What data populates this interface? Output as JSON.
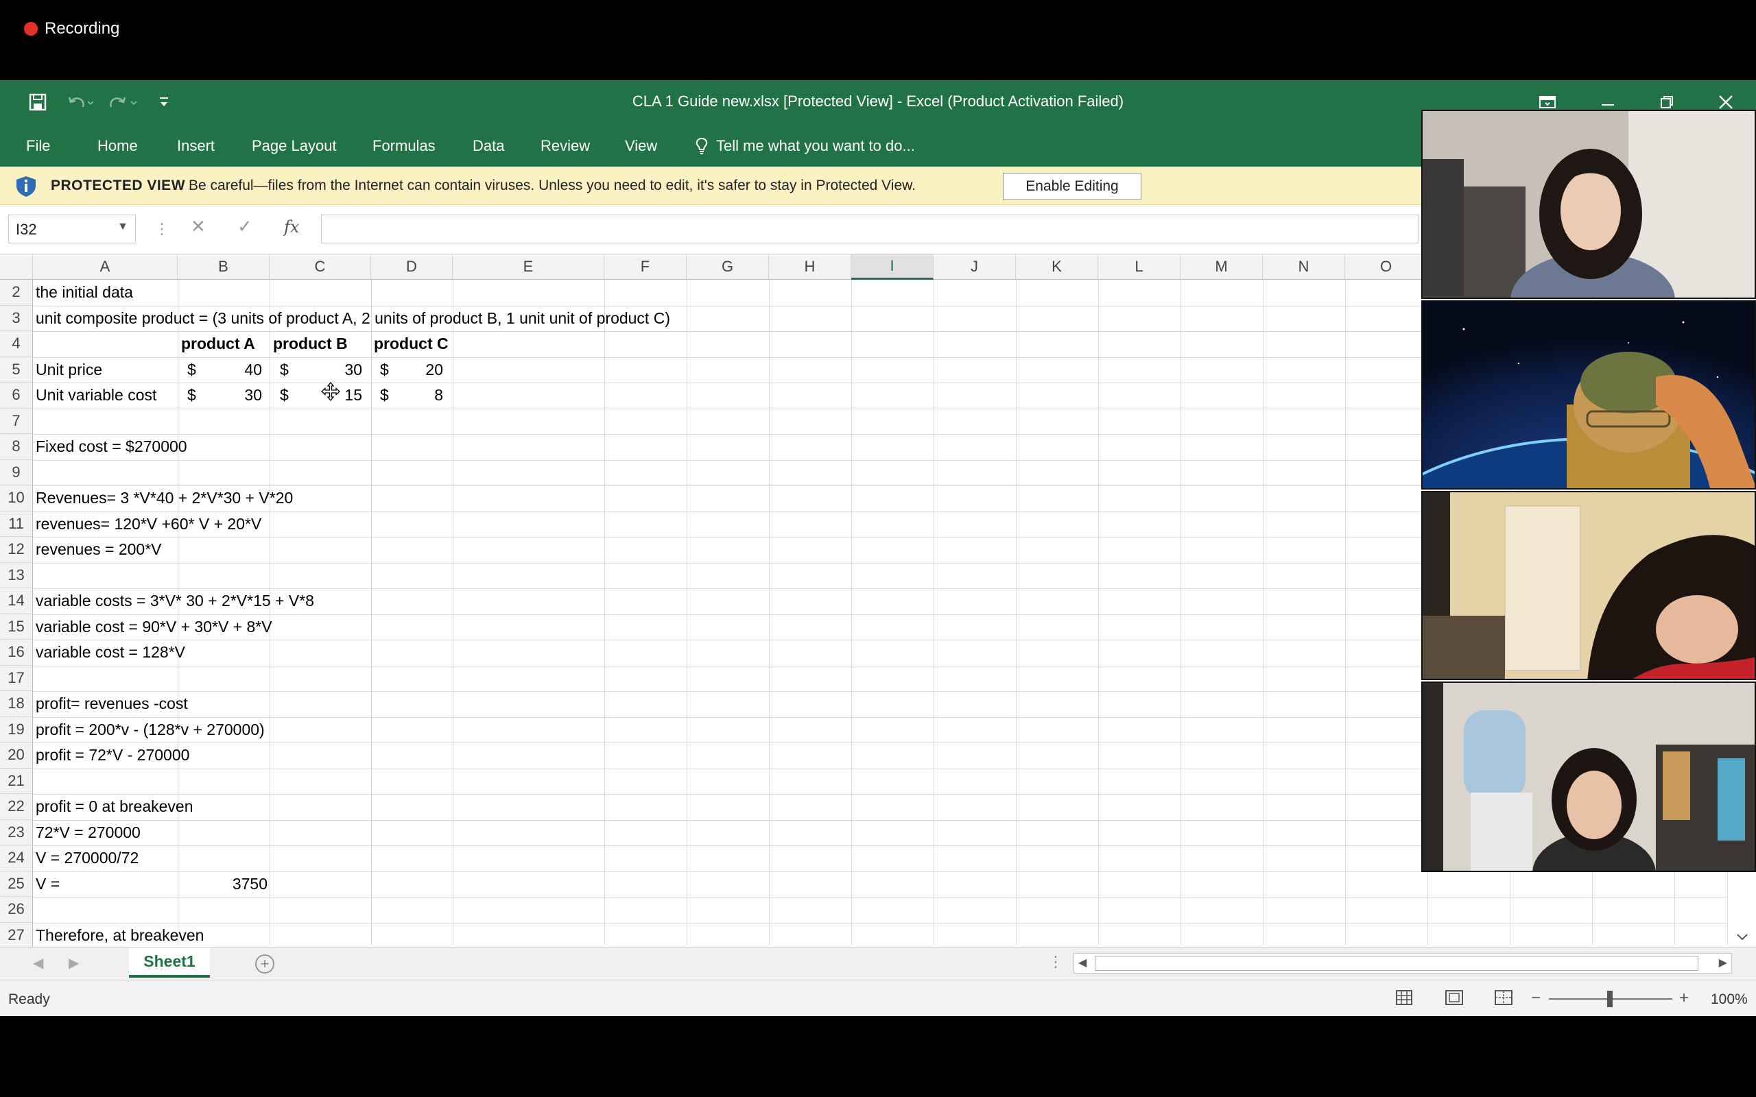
{
  "recording": {
    "label": "Recording"
  },
  "window": {
    "title": "CLA 1 Guide new.xlsx  [Protected View] - Excel (Product Activation Failed)"
  },
  "ribbon": {
    "tabs": [
      "File",
      "Home",
      "Insert",
      "Page Layout",
      "Formulas",
      "Data",
      "Review",
      "View"
    ],
    "tell_me": "Tell me what you want to do..."
  },
  "protected_view": {
    "label": "PROTECTED VIEW",
    "message": "Be careful—files from the Internet can contain viruses. Unless you need to edit, it's safer to stay in Protected View.",
    "button": "Enable Editing"
  },
  "formula_bar": {
    "name_box": "I32",
    "formula": "",
    "fx_label": "fx"
  },
  "grid": {
    "columns": [
      "A",
      "B",
      "C",
      "D",
      "E",
      "F",
      "G",
      "H",
      "I",
      "J",
      "K",
      "L",
      "M",
      "N",
      "O"
    ],
    "selected_column": "I",
    "rows": [
      "2",
      "3",
      "4",
      "5",
      "6",
      "7",
      "8",
      "9",
      "10",
      "11",
      "12",
      "13",
      "14",
      "15",
      "16",
      "17",
      "18",
      "19",
      "20",
      "21",
      "22",
      "23",
      "24",
      "25",
      "26",
      "27"
    ],
    "cells": {
      "r2_a": "the  initial data",
      "r3_a": "unit composite product = (3 units of product A, 2 units of product B, 1 unit unit of product C)",
      "r4_b": "product A",
      "r4_c": "product B",
      "r4_d": "product C",
      "r5_a": "Unit price",
      "r5_b_cur": "$",
      "r5_b": "40",
      "r5_c_cur": "$",
      "r5_c": "30",
      "r5_d_cur": "$",
      "r5_d": "20",
      "r6_a": "Unit variable cost",
      "r6_b_cur": "$",
      "r6_b": "30",
      "r6_c_cur": "$",
      "r6_c": "15",
      "r6_d_cur": "$",
      "r6_d": "8",
      "r8_a": "Fixed cost = $270000",
      "r10_a": "Revenues= 3 *V*40 + 2*V*30 + V*20",
      "r11_a": "revenues= 120*V +60* V + 20*V",
      "r12_a": "revenues = 200*V",
      "r14_a": "variable costs = 3*V* 30 + 2*V*15 + V*8",
      "r15_a": "variable cost = 90*V + 30*V + 8*V",
      "r16_a": "variable cost = 128*V",
      "r18_a": "profit= revenues -cost",
      "r19_a": "profit = 200*v - (128*v + 270000)",
      "r20_a": "profit = 72*V - 270000",
      "r22_a": "profit = 0 at breakeven",
      "r23_a": "72*V = 270000",
      "r24_a": "V = 270000/72",
      "r25_a": "V =",
      "r25_b": "3750",
      "r27_a": "Therefore, at breakeven"
    }
  },
  "sheets": {
    "active": "Sheet1"
  },
  "status": {
    "ready": "Ready",
    "zoom": "100%"
  },
  "participants": [
    {
      "name": "participant-1",
      "bg": "#c9c2ba"
    },
    {
      "name": "participant-2",
      "bg": "#0a1a3a"
    },
    {
      "name": "participant-3",
      "bg": "#e6d3a8"
    },
    {
      "name": "participant-4",
      "bg": "#d8d4cc"
    }
  ],
  "colors": {
    "excel_green": "#217346",
    "protected_bar": "#fbf2c4",
    "record_red": "#e5302a"
  }
}
